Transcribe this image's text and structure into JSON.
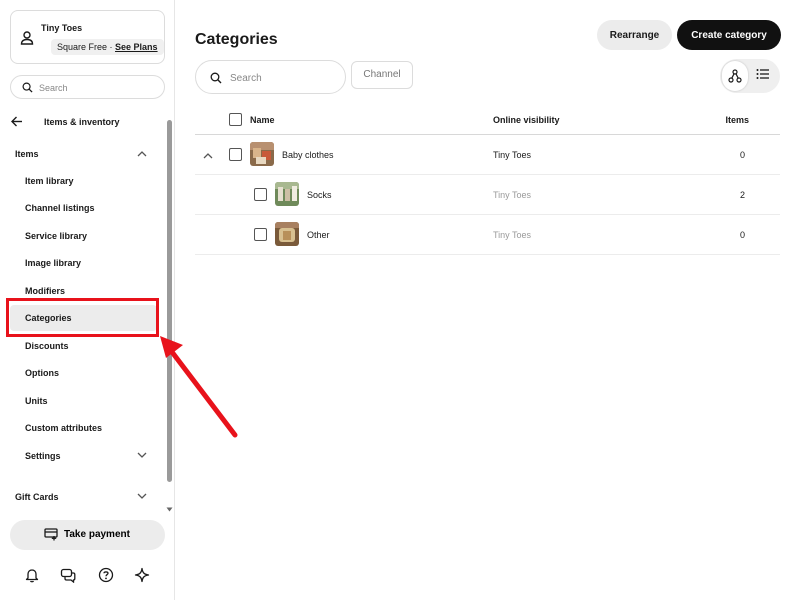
{
  "sidebar": {
    "account": {
      "name": "Tiny Toes",
      "plan": "Square Free · ",
      "see_plans": "See Plans"
    },
    "search_placeholder": "Search",
    "back_label": "Items & inventory",
    "items_section": "Items",
    "nav": [
      {
        "label": "Item library"
      },
      {
        "label": "Channel listings"
      },
      {
        "label": "Service library"
      },
      {
        "label": "Image library"
      },
      {
        "label": "Modifiers"
      },
      {
        "label": "Categories",
        "active": true
      },
      {
        "label": "Discounts"
      },
      {
        "label": "Options"
      },
      {
        "label": "Units"
      },
      {
        "label": "Custom attributes"
      },
      {
        "label": "Settings"
      }
    ],
    "gift_cards": "Gift Cards",
    "take_payment": "Take payment",
    "footer_icons": [
      "bell-icon",
      "chat-icon",
      "help-icon",
      "sparkle-icon"
    ]
  },
  "main": {
    "title": "Categories",
    "rearrange_label": "Rearrange",
    "create_label": "Create category",
    "search_placeholder": "Search",
    "channel_label": "Channel",
    "view_icons": [
      "tree-view-icon",
      "list-view-icon"
    ],
    "table": {
      "headers": {
        "name": "Name",
        "visibility": "Online visibility",
        "items": "Items"
      },
      "rows": [
        {
          "name": "Baby clothes",
          "visibility": "Tiny Toes",
          "items": "0",
          "level": 0,
          "expanded": true
        },
        {
          "name": "Socks",
          "visibility": "Tiny Toes",
          "items": "2",
          "level": 1
        },
        {
          "name": "Other",
          "visibility": "Tiny Toes",
          "items": "0",
          "level": 1
        }
      ]
    }
  },
  "colors": {
    "annotation_red": "#e8121b",
    "primary_button": "#111111",
    "active_nav": "#ececec",
    "muted_text": "#9a9a9a"
  }
}
